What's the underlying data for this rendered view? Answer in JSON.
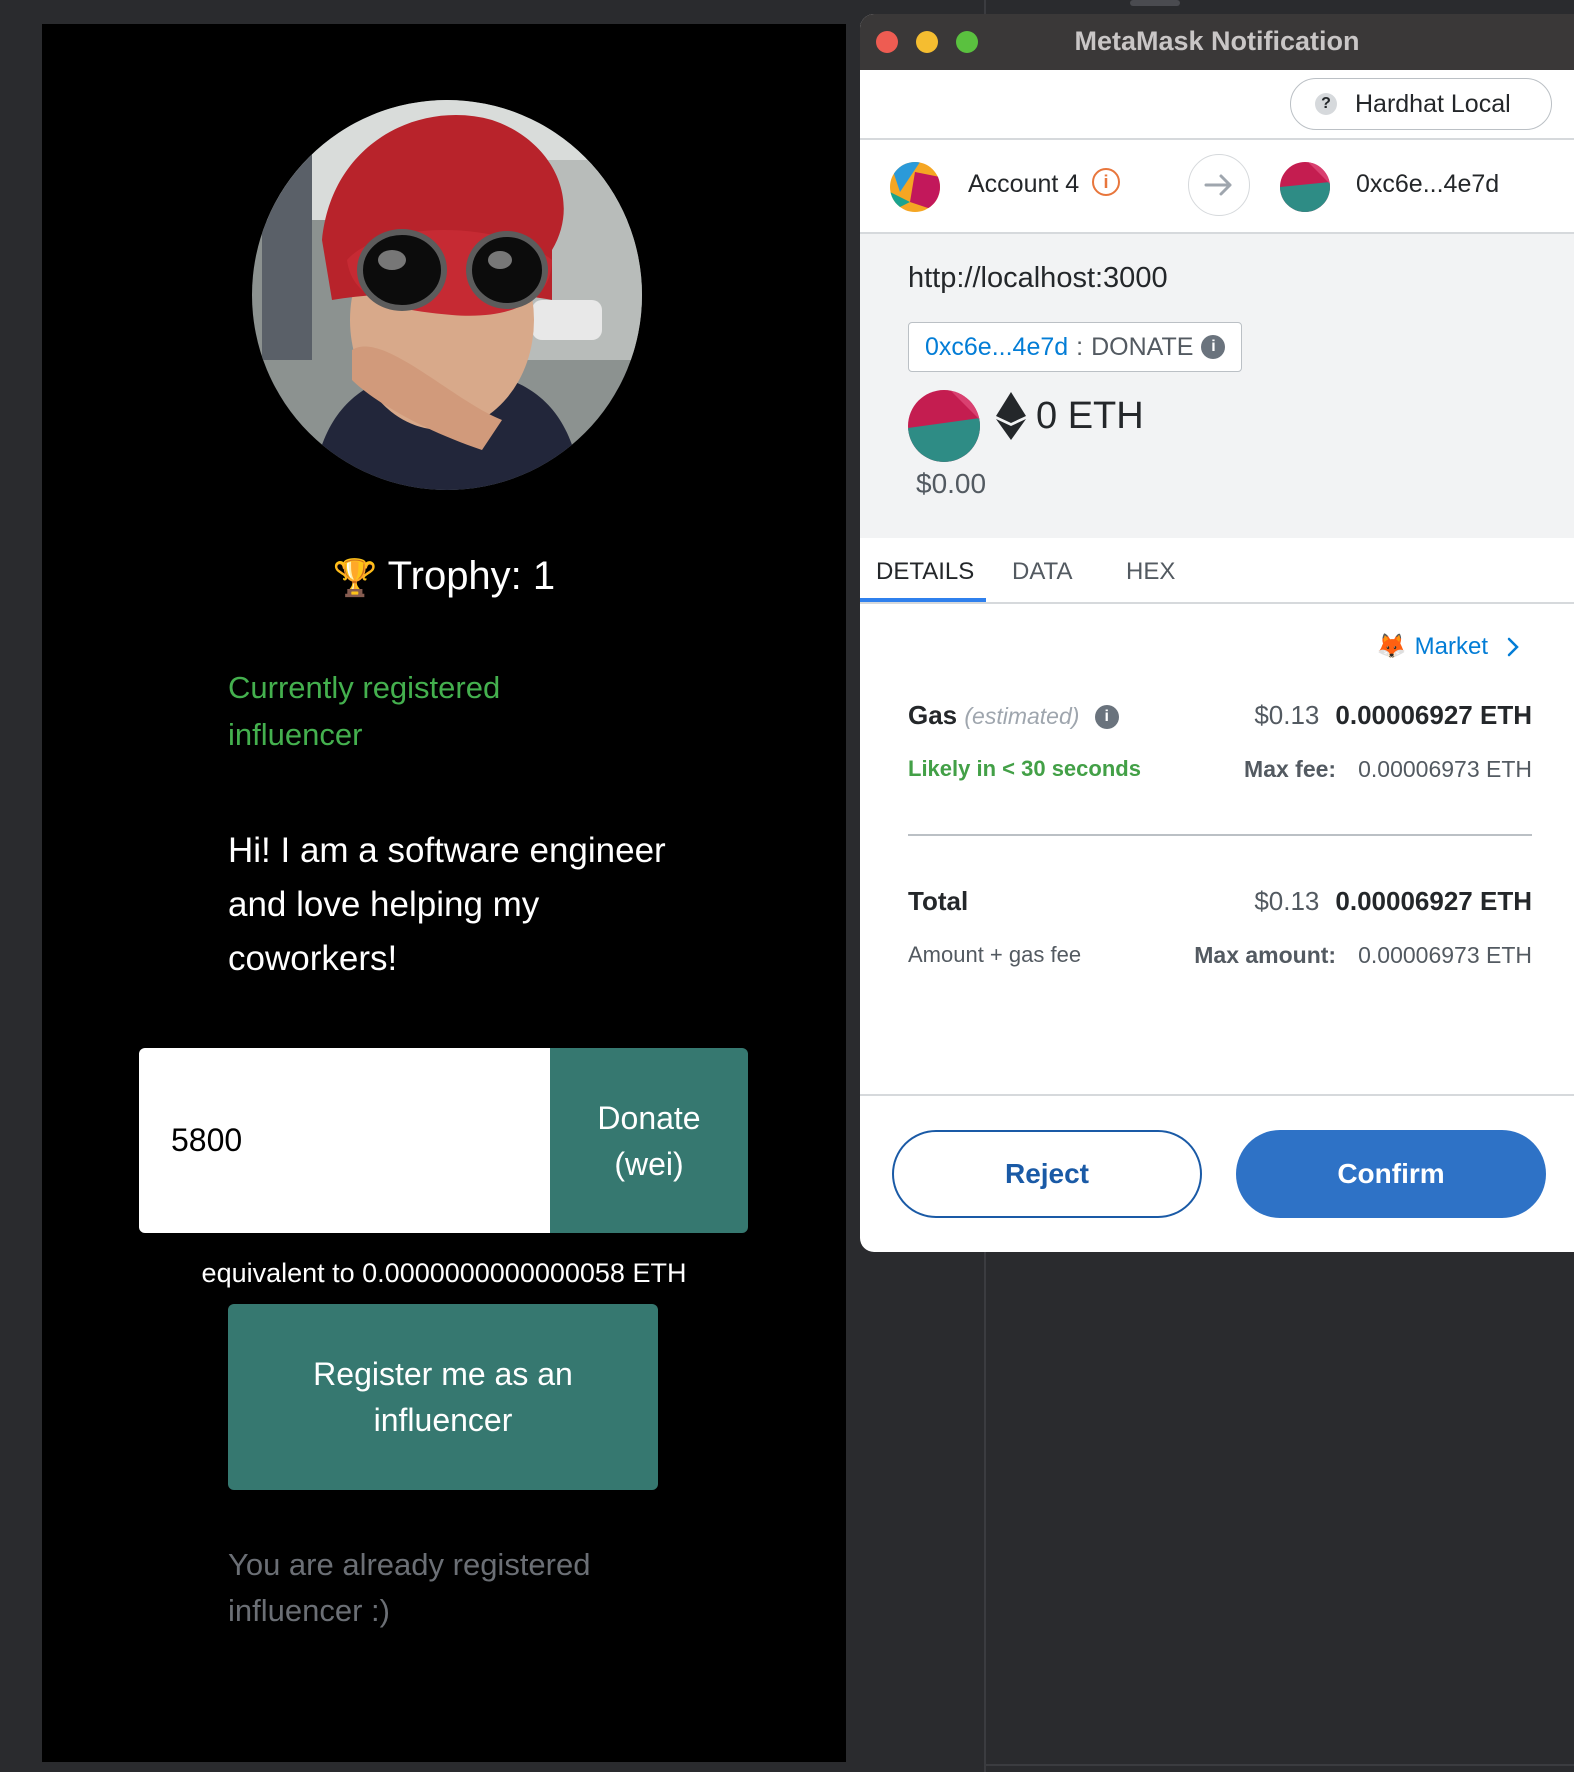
{
  "app": {
    "trophy_emoji": "🏆",
    "trophy_text": "Trophy: 1",
    "registered_status": "Currently registered influencer",
    "bio": "Hi! I am a software engineer and love helping my coworkers!",
    "donate_value": "5800",
    "donate_button": "Donate (wei)",
    "equivalent": "equivalent to 0.0000000000000058 ETH",
    "register_button": "Register me as an influencer",
    "already_registered": "You are already registered influencer :)"
  },
  "metamask": {
    "window_title": "MetaMask Notification",
    "network": "Hardhat Local",
    "from_account": "Account 4",
    "to_address": "0xc6e...4e7d",
    "origin": "http://localhost:3000",
    "method_address": "0xc6e...4e7d",
    "method_separator": ":",
    "method_name": "DONATE",
    "amount": "0 ETH",
    "amount_fiat": "$0.00",
    "tabs": [
      {
        "label": "DETAILS"
      },
      {
        "label": "DATA"
      },
      {
        "label": "HEX"
      }
    ],
    "market_label": "Market",
    "gas": {
      "label": "Gas",
      "qualifier": "(estimated)",
      "fiat": "$0.13",
      "eth": "0.00006927 ETH",
      "likely": "Likely in < 30 seconds",
      "max_fee_label": "Max fee:",
      "max_fee_value": "0.00006973 ETH"
    },
    "total": {
      "label": "Total",
      "fiat": "$0.13",
      "eth": "0.00006927 ETH",
      "sub": "Amount + gas fee",
      "max_amount_label": "Max amount:",
      "max_amount_value": "0.00006973 ETH"
    },
    "reject": "Reject",
    "confirm": "Confirm",
    "colors": {
      "link": "#037dd6",
      "confirm": "#2e72c6",
      "green": "#43a047",
      "app_button": "#367870",
      "app_status": "#44b04e"
    }
  }
}
